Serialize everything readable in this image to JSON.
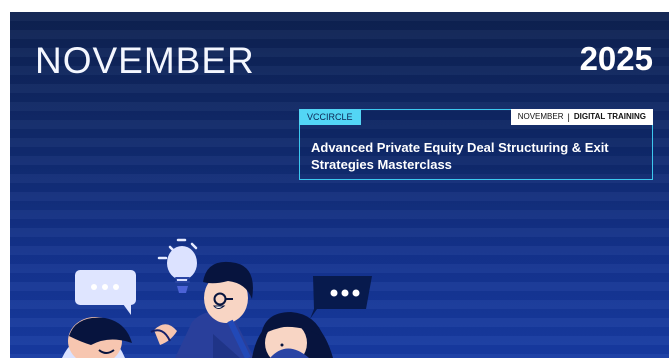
{
  "banner": {
    "month": "NOVEMBER",
    "year": "2025"
  },
  "card": {
    "brand": "VCCIRCLE",
    "month_tag": "NOVEMBER",
    "separator": "|",
    "training_type": "DIGITAL TRAINING",
    "title": "Advanced Private Equity Deal Structuring & Exit Strategies Masterclass"
  },
  "illustration": {
    "icons": [
      "lightbulb-icon",
      "speech-bubble-icon",
      "speech-bubble-icon"
    ],
    "colors": {
      "background_top": "#0d2150",
      "background_bottom": "#173ba3",
      "accent": "#53d6f5",
      "bubble_light": "#dfe5ff",
      "bubble_dark": "#071a4d"
    }
  }
}
